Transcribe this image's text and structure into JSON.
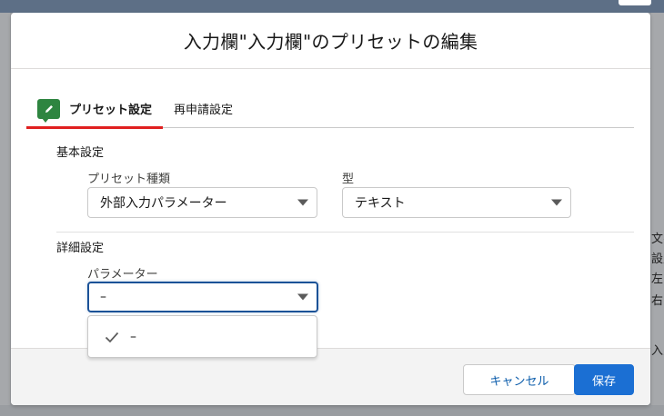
{
  "modal": {
    "title": "入力欄\"入力欄\"のプリセットの編集"
  },
  "tabs": [
    {
      "label": "プリセット設定",
      "active": true,
      "icon": "pencil-icon"
    },
    {
      "label": "再申請設定",
      "active": false
    }
  ],
  "basic_settings": {
    "heading": "基本設定",
    "preset_type": {
      "label": "プリセット種類",
      "value": "外部入力パラメーター"
    },
    "type": {
      "label": "型",
      "value": "テキスト"
    }
  },
  "detail_settings": {
    "heading": "詳細設定",
    "parameter": {
      "label": "パラメーター",
      "value": "–"
    },
    "dropdown_options": [
      {
        "label": "–",
        "selected": true
      }
    ]
  },
  "footer": {
    "cancel_label": "キャンセル",
    "save_label": "保存"
  },
  "background": {
    "side_texts": [
      "文字",
      "設定",
      "左に",
      "右に",
      "入力"
    ]
  },
  "colors": {
    "accent_tab_underline": "#e02020",
    "tab_icon_bg": "#2e8540",
    "primary_button": "#1b6fd3",
    "focus_border": "#1b5297"
  }
}
